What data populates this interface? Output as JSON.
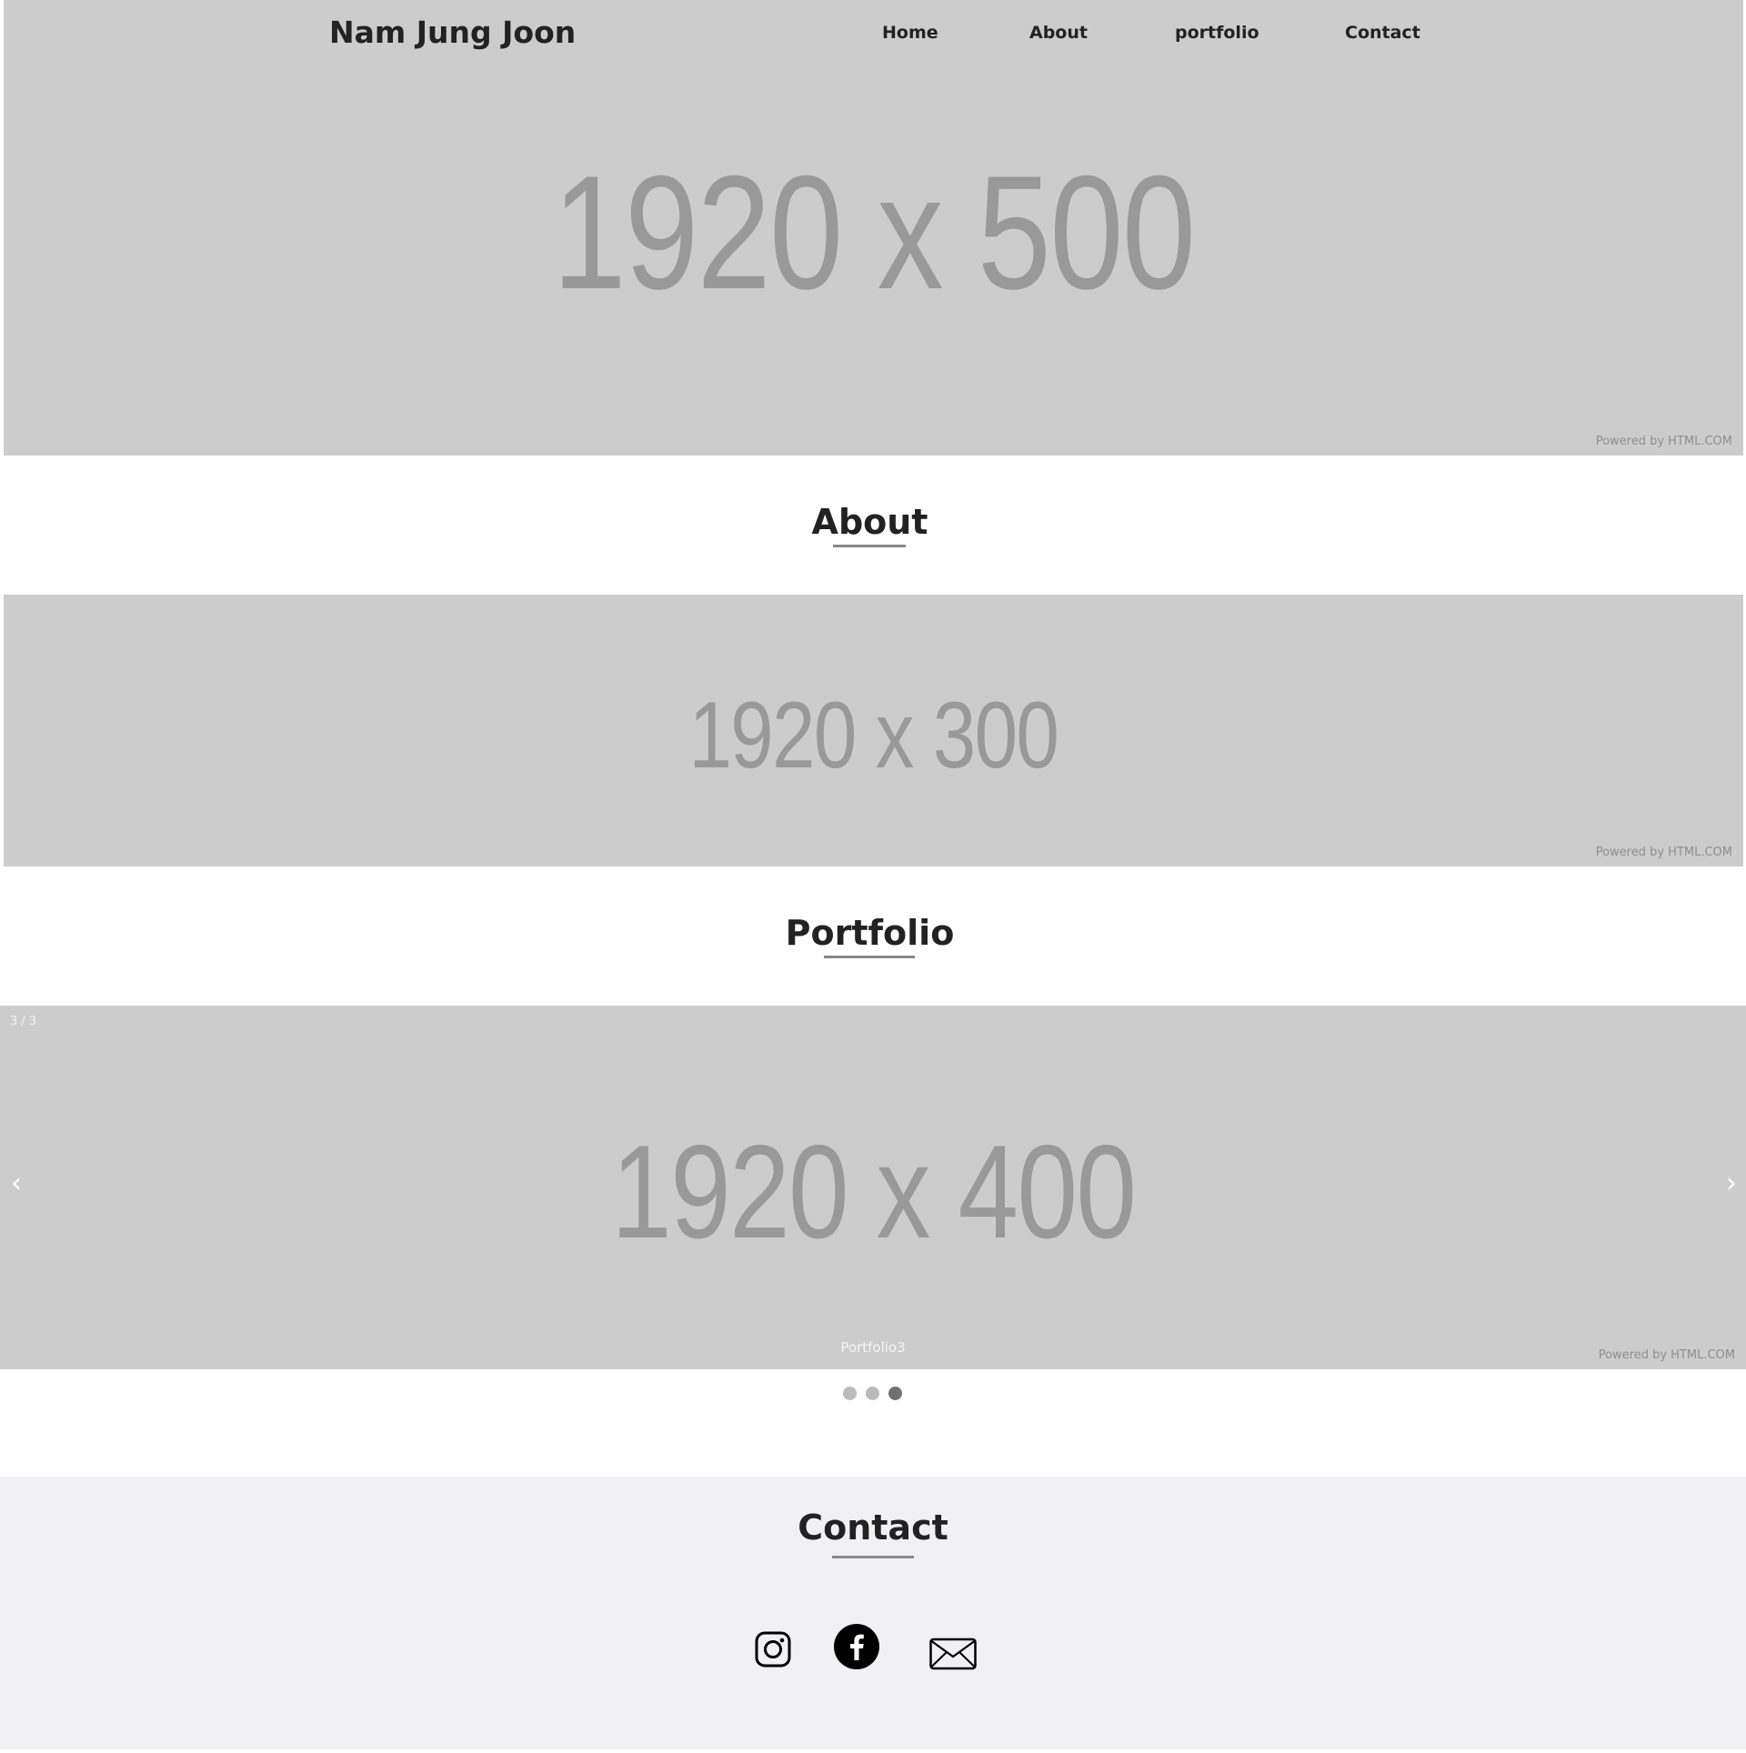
{
  "header": {
    "brand": "Nam Jung Joon",
    "nav": [
      {
        "label": "Home"
      },
      {
        "label": "About"
      },
      {
        "label": "portfolio"
      },
      {
        "label": "Contact"
      }
    ]
  },
  "hero": {
    "placeholder": "1920 x 500",
    "powered": "Powered by HTML.COM"
  },
  "about": {
    "title": "About",
    "placeholder": "1920 x 300",
    "powered": "Powered by HTML.COM"
  },
  "portfolio": {
    "title": "Portfolio",
    "slider": {
      "counter": "3 / 3",
      "placeholder": "1920 x 400",
      "caption": "Portfolio3",
      "powered": "Powered by HTML.COM",
      "prev": "‹",
      "next": "›",
      "active_dot": 3,
      "dot_count": 3
    }
  },
  "contact": {
    "title": "Contact",
    "socials": [
      "instagram-icon",
      "facebook-icon",
      "mail-icon"
    ]
  },
  "colors": {
    "placeholder_bg": "#cccccc",
    "placeholder_text": "#999999",
    "footer_bg": "#f1f1f3",
    "dot_inactive": "#bbbbbb",
    "dot_active": "#717171"
  }
}
